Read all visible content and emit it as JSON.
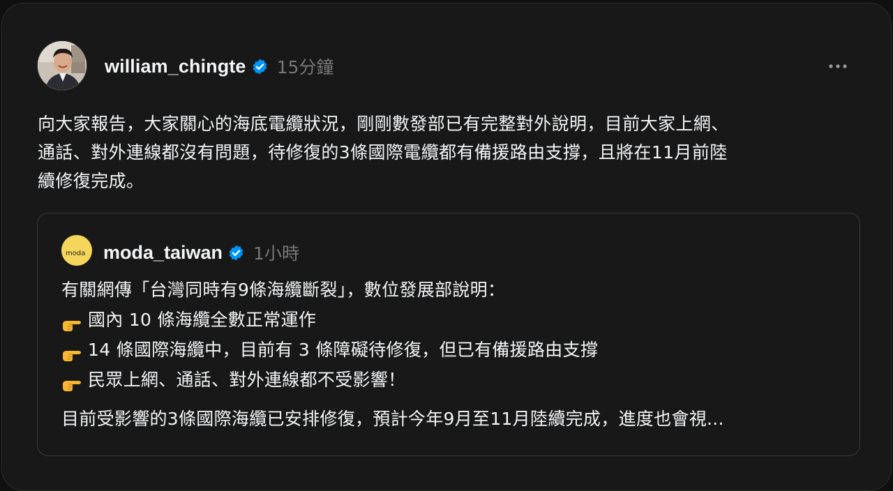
{
  "post": {
    "username": "william_chingte",
    "time": "15分鐘",
    "text": "向大家報告，大家關心的海底電纜狀況，剛剛數發部已有完整對外說明，目前大家上網、\n通話、對外連線都沒有問題，待修復的3條國際電纜都有備援路由支撐，且將在11月前陸\n續修復完成。",
    "verified_icon": "verified-badge-icon",
    "more_icon": "more-horizontal-icon"
  },
  "quoted": {
    "username": "moda_taiwan",
    "time": "1小時",
    "avatar_text": "moda",
    "intro": "有關網傳「台灣同時有9條海纜斷裂」，數位發展部說明：",
    "bullets": [
      "國內 10 條海纜全數正常運作",
      "14 條國際海纜中，目前有 3 條障礙待修復，但已有備援路由支撐",
      "民眾上網、通話、對外連線都不受影響！"
    ],
    "body": "目前受影響的3條國際海纜已安排修復，預計今年9月至11月陸續完成，進度也會視...",
    "bullet_icon": "pointing-hand-icon"
  },
  "colors": {
    "background": "#181818",
    "text": "#f3f5f7",
    "muted": "#777777",
    "verified": "#0095f6",
    "moda_yellow": "#f6d65a"
  }
}
